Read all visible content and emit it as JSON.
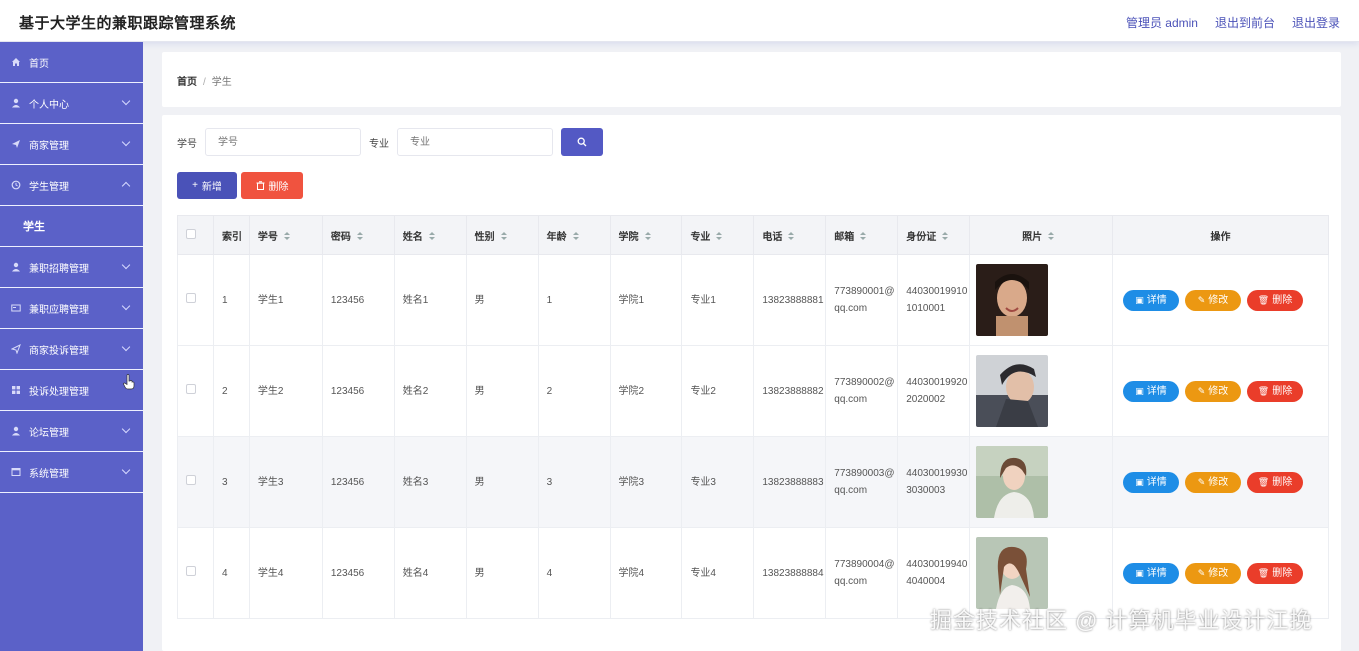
{
  "header": {
    "title": "基于大学生的兼职跟踪管理系统",
    "links": [
      "管理员 admin",
      "退出到前台",
      "退出登录"
    ]
  },
  "sidebar": {
    "items": [
      {
        "label": "首页",
        "icon": "home-icon",
        "chevron": false
      },
      {
        "label": "个人中心",
        "icon": "user-icon",
        "chevron": "down"
      },
      {
        "label": "商家管理",
        "icon": "send-icon",
        "chevron": "down"
      },
      {
        "label": "学生管理",
        "icon": "clock-icon",
        "chevron": "up"
      },
      {
        "label": "学生",
        "sub": true
      },
      {
        "label": "兼职招聘管理",
        "icon": "user-icon",
        "chevron": "down"
      },
      {
        "label": "兼职应聘管理",
        "icon": "card-icon",
        "chevron": "down"
      },
      {
        "label": "商家投诉管理",
        "icon": "send-icon",
        "chevron": "down"
      },
      {
        "label": "投诉处理管理",
        "icon": "grid-icon",
        "chevron": "down"
      },
      {
        "label": "论坛管理",
        "icon": "user-icon",
        "chevron": "down"
      },
      {
        "label": "系统管理",
        "icon": "window-icon",
        "chevron": "down"
      }
    ]
  },
  "breadcrumb": {
    "home": "首页",
    "separator": "/",
    "current": "学生"
  },
  "search": {
    "student_id_label": "学号",
    "student_id_placeholder": "学号",
    "major_label": "专业",
    "major_placeholder": "专业"
  },
  "actions": {
    "add_label": "新增",
    "delete_label": "删除"
  },
  "table": {
    "columns": [
      "索引",
      "学号",
      "密码",
      "姓名",
      "性别",
      "年龄",
      "学院",
      "专业",
      "电话",
      "邮箱",
      "身份证",
      "照片",
      "操作"
    ],
    "rows": [
      {
        "index": "1",
        "student_id": "学生1",
        "password": "123456",
        "name": "姓名1",
        "gender": "男",
        "age": "1",
        "college": "学院1",
        "major": "专业1",
        "phone": "13823888881",
        "email": "773890001@qq.com",
        "id_card": "440300199101010001"
      },
      {
        "index": "2",
        "student_id": "学生2",
        "password": "123456",
        "name": "姓名2",
        "gender": "男",
        "age": "2",
        "college": "学院2",
        "major": "专业2",
        "phone": "13823888882",
        "email": "773890002@qq.com",
        "id_card": "440300199202020002"
      },
      {
        "index": "3",
        "student_id": "学生3",
        "password": "123456",
        "name": "姓名3",
        "gender": "男",
        "age": "3",
        "college": "学院3",
        "major": "专业3",
        "phone": "13823888883",
        "email": "773890003@qq.com",
        "id_card": "440300199303030003"
      },
      {
        "index": "4",
        "student_id": "学生4",
        "password": "123456",
        "name": "姓名4",
        "gender": "男",
        "age": "4",
        "college": "学院4",
        "major": "专业4",
        "phone": "13823888884",
        "email": "773890004@qq.com",
        "id_card": "440300199404040004"
      }
    ],
    "row_actions": {
      "detail": "详情",
      "edit": "修改",
      "delete": "删除"
    }
  },
  "watermark": "掘金技术社区 @ 计算机毕业设计江挽"
}
